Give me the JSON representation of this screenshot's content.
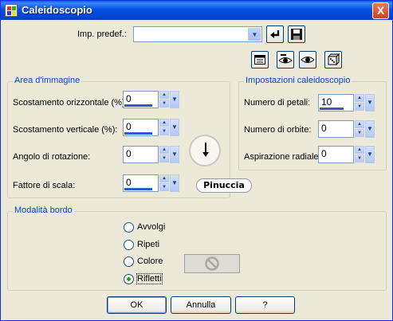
{
  "window": {
    "title": "Caleidoscopio",
    "close_label": "X"
  },
  "preset": {
    "label": "Imp. predef.:",
    "value": ""
  },
  "icons": {
    "app": "kaleidoscope-app-icon",
    "reset": "undo-icon",
    "save": "save-disk-icon",
    "t1": "proof-window-icon",
    "t2": "eye-undo-icon",
    "t3": "eye-icon",
    "t4": "dice-icon",
    "no_color": "no-symbol-icon",
    "dial": "rotation-dial-icon"
  },
  "area": {
    "title": "Area d'immagine",
    "fields": [
      {
        "label": "Scostamento orizzontale (%):",
        "value": "0"
      },
      {
        "label": "Scostamento verticale (%):",
        "value": "0"
      },
      {
        "label": "Angolo di rotazione:",
        "value": "0"
      },
      {
        "label": "Fattore di scala:",
        "value": "0"
      }
    ]
  },
  "settings": {
    "title": "Impostazioni caleidoscopio",
    "fields": [
      {
        "label": "Numero di petali:",
        "value": "10"
      },
      {
        "label": "Numero di orbite:",
        "value": "0"
      },
      {
        "label": "Aspirazione radiale:",
        "value": "0"
      }
    ]
  },
  "watermark": "Pinuccia",
  "border": {
    "title": "Modalità bordo",
    "options": [
      "Avvolgi",
      "Ripeti",
      "Colore",
      "Rifletti"
    ],
    "selected": "Rifletti"
  },
  "buttons": {
    "ok": "OK",
    "cancel": "Annulla",
    "help": "?"
  },
  "colors": {
    "accent": "#0046D5",
    "title_bar": "#0550E3",
    "face": "#ECE9D8"
  }
}
